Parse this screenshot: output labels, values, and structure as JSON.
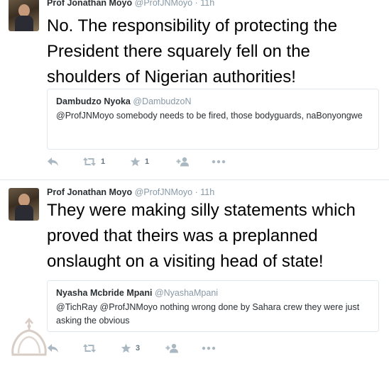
{
  "tweets": [
    {
      "author": {
        "name": "Prof Jonathan Moyo",
        "handle": "@ProfJNMoyo",
        "time": "11h"
      },
      "text": "No. The responsibility of protecting the President there squarely fell on the shoulders of Nigerian authorities!",
      "quote": {
        "name": "Dambudzo Nyoka",
        "handle": "@DambudzoN",
        "text": "@ProfJNMoyo somebody needs to be fired, those bodyguards, naBonyongwe"
      },
      "actions": {
        "retweets": "1",
        "favorites": "1"
      }
    },
    {
      "author": {
        "name": "Prof Jonathan Moyo",
        "handle": "@ProfJNMoyo",
        "time": "11h"
      },
      "text": "They were making silly statements which proved that theirs was a preplanned onslaught on a visiting head of state!",
      "quote": {
        "name": "Nyasha Mcbride Mpani",
        "handle": "@NyashaMpani",
        "text": "@TichRay @ProfJNMoyo nothing wrong done by Sahara crew they were just asking the obvious"
      },
      "actions": {
        "retweets": "",
        "favorites": "3"
      }
    }
  ],
  "separator": "·",
  "icons": {
    "reply": "reply-icon",
    "retweet": "retweet-icon",
    "favorite": "star-icon",
    "follow": "follow-icon",
    "more": "more-icon"
  },
  "colors": {
    "icon": "#aab8c2",
    "meta": "#8899a6",
    "border": "#e1e8ed"
  }
}
